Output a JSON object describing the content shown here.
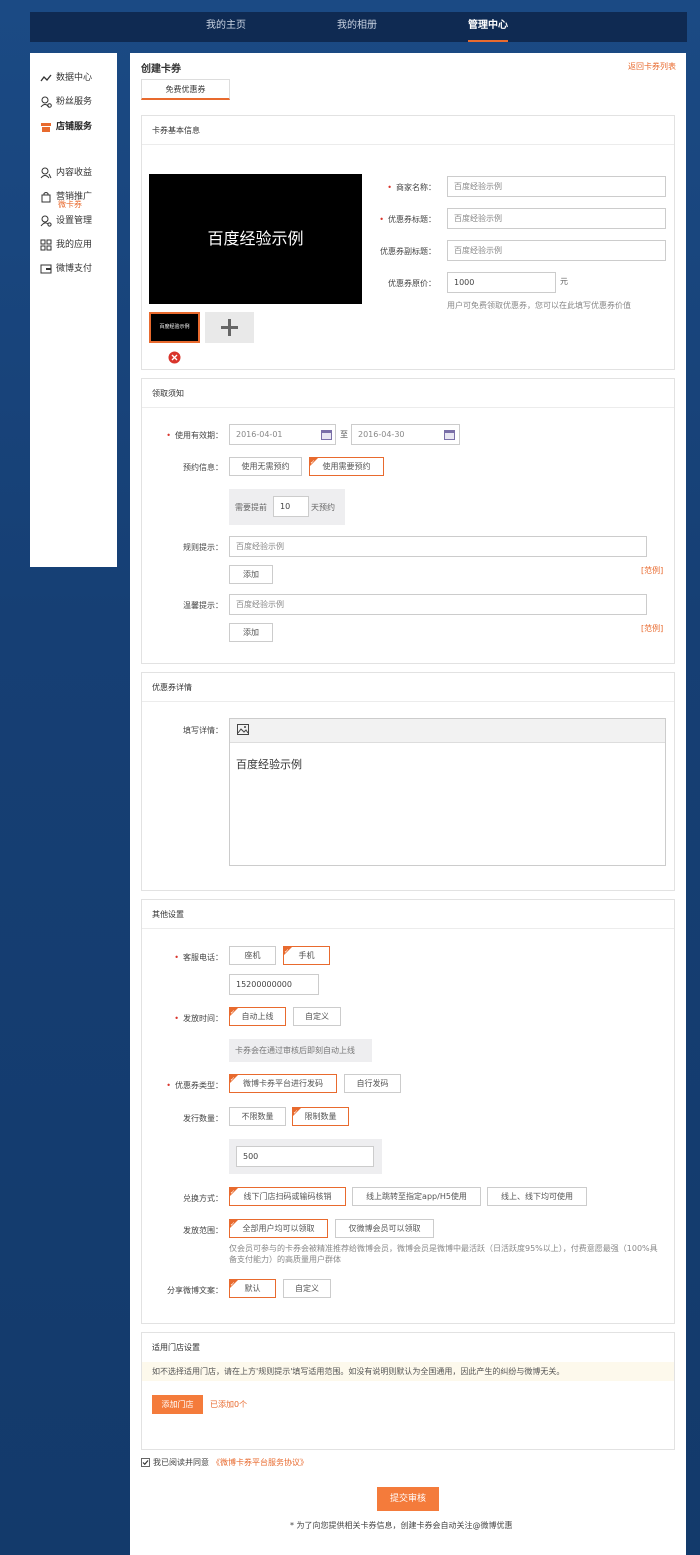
{
  "topnav": {
    "items": [
      "我的主页",
      "我的相册",
      "管理中心"
    ],
    "active_index": 2
  },
  "sidebar": {
    "items": [
      {
        "label": "数据中心",
        "icon": "trend-icon"
      },
      {
        "label": "粉丝服务",
        "icon": "fans-icon"
      },
      {
        "label": "店铺服务",
        "icon": "store-icon"
      },
      {
        "label": "内容收益",
        "icon": "profit-icon"
      },
      {
        "label": "营销推广",
        "icon": "bag-icon"
      },
      {
        "label": "设置管理",
        "icon": "settings-user-icon"
      },
      {
        "label": "我的应用",
        "icon": "apps-grid-icon"
      },
      {
        "label": "微博支付",
        "icon": "wallet-icon"
      }
    ],
    "active_label": "店铺服务",
    "sub_item": "微卡券"
  },
  "page": {
    "title": "创建卡券",
    "back_link": "返回卡券列表",
    "tab": "免费优惠券"
  },
  "basic": {
    "title": "卡券基本信息",
    "preview_text": "百度经验示例",
    "thumb_text": "百度经验示例",
    "merchant_label": "商家名称：",
    "merchant_value": "百度经验示例",
    "title_label": "优惠券标题：",
    "title_value": "百度经验示例",
    "subtitle_label": "优惠券副标题：",
    "subtitle_value": "百度经验示例",
    "price_label": "优惠券原价：",
    "price_value": "1000",
    "price_unit": "元",
    "price_hint": "用户可免费领取优惠券，您可以在此填写优惠券价值"
  },
  "notice": {
    "title": "领取须知",
    "validity_label": "使用有效期：",
    "date_start": "2016-04-01",
    "date_sep": "至",
    "date_end": "2016-04-30",
    "reserve_label": "预约信息：",
    "reserve_options": [
      "使用无需预约",
      "使用需要预约"
    ],
    "reserve_selected": 1,
    "advance_prefix": "需要提前",
    "advance_days": "10",
    "advance_suffix": "天预约",
    "rule_label": "规则提示：",
    "rule_value": "百度经验示例",
    "add_label": "添加",
    "example_label": "[范例]",
    "tip_label": "温馨提示：",
    "tip_value": "百度经验示例"
  },
  "detail": {
    "title": "优惠券详情",
    "fill_label": "填写详情：",
    "content": "百度经验示例"
  },
  "other": {
    "title": "其他设置",
    "phone_label": "客服电话：",
    "phone_options": [
      "座机",
      "手机"
    ],
    "phone_selected": 1,
    "phone_value": "15200000000",
    "release_label": "发放时间：",
    "release_options": [
      "自动上线",
      "自定义"
    ],
    "release_selected": 0,
    "release_hint": "卡券会在通过审核后即刻自动上线",
    "type_label": "优惠券类型：",
    "type_options": [
      "微博卡券平台进行发码",
      "自行发码"
    ],
    "type_selected": 0,
    "qty_label": "发行数量：",
    "qty_options": [
      "不限数量",
      "限制数量"
    ],
    "qty_selected": 1,
    "qty_value": "500",
    "redeem_label": "兑换方式：",
    "redeem_options": [
      "线下门店扫码或输码核销",
      "线上跳转至指定app/H5使用",
      "线上、线下均可使用"
    ],
    "redeem_selected": 0,
    "scope_label": "发放范围：",
    "scope_options": [
      "全部用户均可以领取",
      "仅微博会员可以领取"
    ],
    "scope_selected": 0,
    "scope_hint": "仅会员可参与的卡券会被精准推荐给微博会员，微博会员是微博中最活跃（日活跃度95%以上），付费意愿最强（100%具备支付能力）的高质量用户群体",
    "share_label": "分享微博文案：",
    "share_options": [
      "默认",
      "自定义"
    ],
    "share_selected": 0
  },
  "store": {
    "title": "适用门店设置",
    "notice": "如不选择适用门店，请在上方'规则提示'填写适用范围。如没有说明则默认为全国通用，因此产生的纠纷与微博无关。",
    "add_button": "添加门店",
    "added": "已添加0个"
  },
  "agree": {
    "prefix": "我已阅读并同意",
    "link": "《微博卡券平台服务协议》"
  },
  "submit": {
    "label": "提交审核",
    "note": "* 为了向您提供相关卡券信息，创建卡券会自动关注@微博优惠"
  }
}
